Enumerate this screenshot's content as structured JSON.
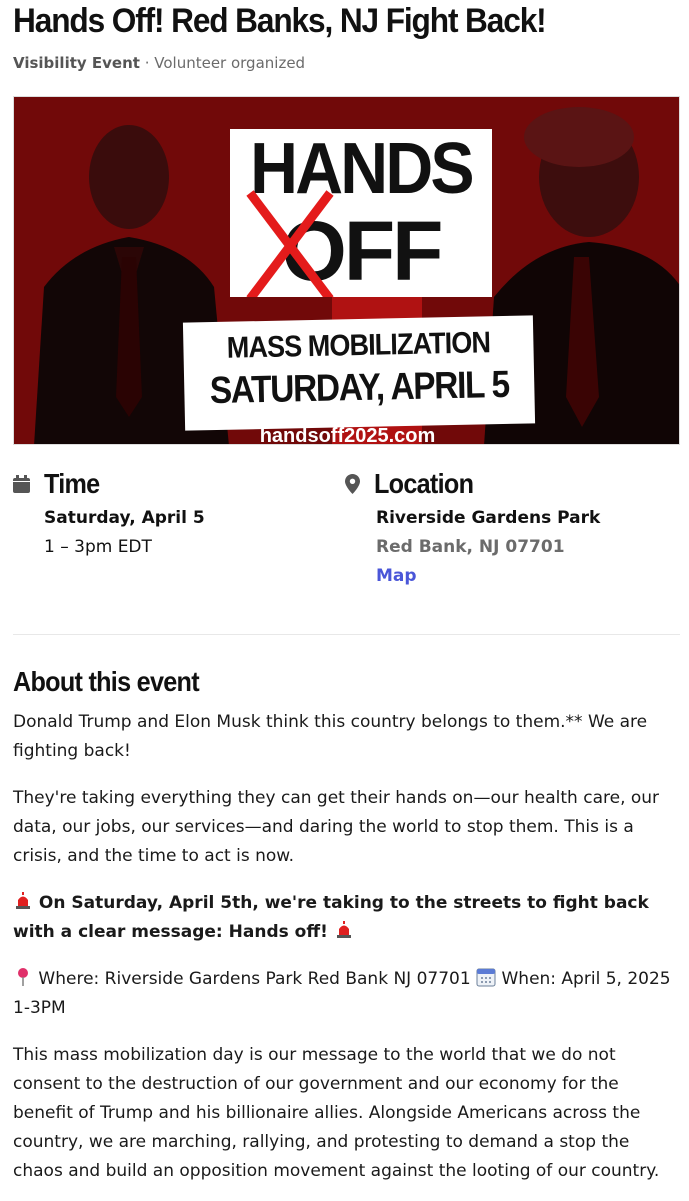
{
  "header": {
    "title": "Hands Off! Red Banks, NJ Fight Back!",
    "event_type": "Visibility Event",
    "separator": " · ",
    "organizer": "Volunteer organized"
  },
  "hero": {
    "line1": "HANDS",
    "line2": "OFF",
    "line3": "MASS MOBILIZATION",
    "line4": "SATURDAY, APRIL 5",
    "url": "handsoff2025.com"
  },
  "time": {
    "heading": "Time",
    "date": "Saturday, April 5",
    "hours": "1 – 3pm EDT",
    "icon": "calendar-icon"
  },
  "location": {
    "heading": "Location",
    "name": "Riverside Gardens Park",
    "address": "Red Bank, NJ 07701",
    "map_link": "Map",
    "icon": "map-pin-icon"
  },
  "about": {
    "heading": "About this event",
    "p1": "Donald Trump and Elon Musk think this country belongs to them.** We are fighting back!",
    "p2": "They're taking everything they can get their hands on—our health care, our data, our jobs, our services—and daring the world to stop them. This is a crisis, and the time to act is now.",
    "p3": "On Saturday, April 5th, we're taking to the streets to fight back with a clear message: Hands off!",
    "p4_where": "Where: Riverside Gardens Park Red Bank NJ 07701",
    "p4_when": "When: April 5, 2025 1-3PM",
    "p5": "This mass mobilization day is our message to the world that we do not consent to the destruction of our government and our economy for the benefit of Trump and his billionaire allies. Alongside Americans across the country, we are marching, rallying, and protesting to demand a stop the chaos and build an opposition movement against the looting of our country."
  },
  "colors": {
    "link": "#4a56d8",
    "hero_red": "#7a0a0a",
    "cross_red": "#e41b1b"
  }
}
